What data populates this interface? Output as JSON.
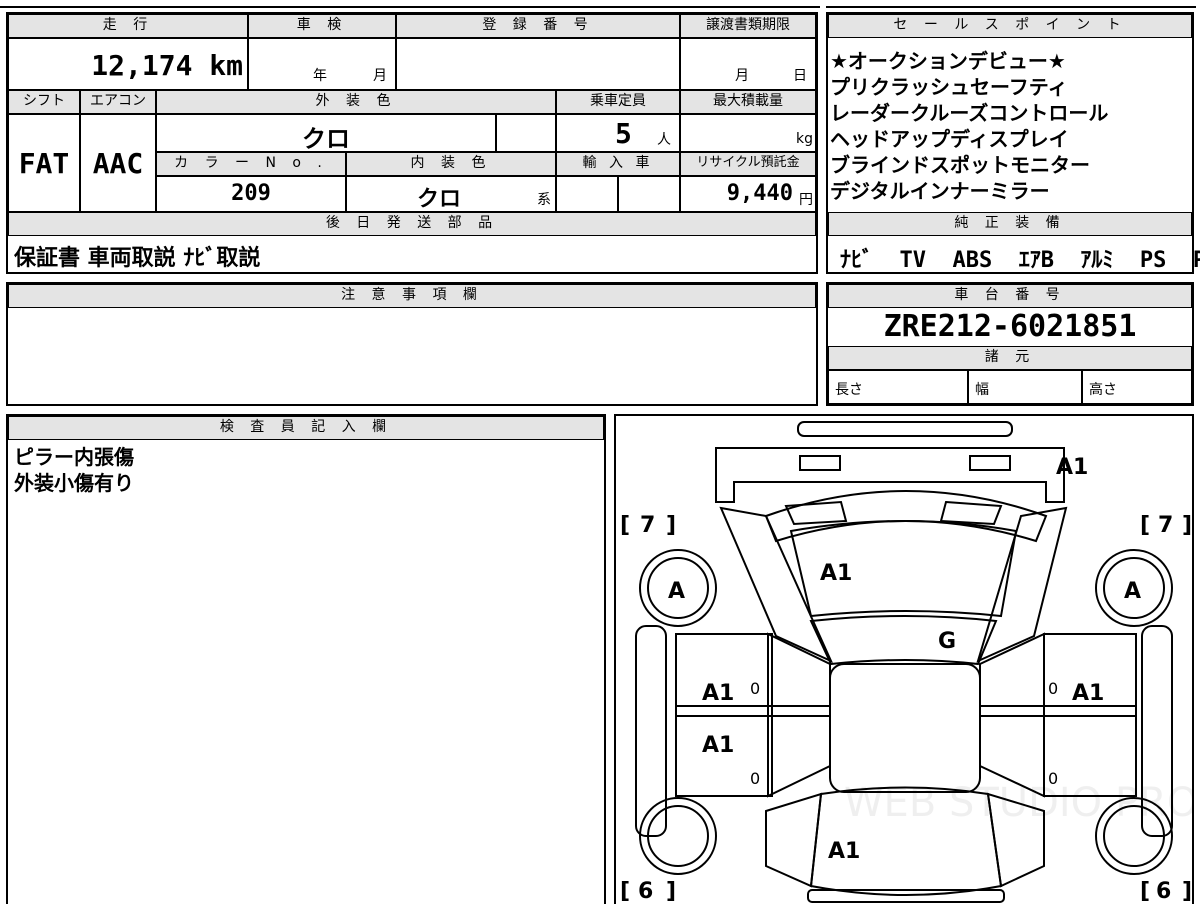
{
  "headers": {
    "mileage": "走 行",
    "inspection": "車 検",
    "registration": "登 録 番 号",
    "transfer_deadline": "譲渡書類期限",
    "shift": "シフト",
    "aircon": "エアコン",
    "exterior_color": "外 装 色",
    "capacity": "乗車定員",
    "max_load": "最大積載量",
    "color_no": "カ ラ ー N o .",
    "interior_color": "内 装 色",
    "import": "輸 入 車",
    "recycle_fee": "リサイクル預託金",
    "later_parts": "後 日 発 送 部 品",
    "sales_points": "セ ー ル ス ポ イ ン ト",
    "genuine_equipment": "純 正 装 備",
    "notes": "注 意 事 項 欄",
    "chassis_no": "車 台 番 号",
    "specs": "諸 元",
    "inspector_notes": "検 査 員 記 入 欄"
  },
  "values": {
    "mileage": "12,174 km",
    "inspection_year_label": "年",
    "inspection_month_label": "月",
    "deadline_month_label": "月",
    "deadline_day_label": "日",
    "shift": "FAT",
    "aircon": "AAC",
    "exterior_color": "クロ",
    "capacity": "5",
    "capacity_unit": "人",
    "max_load_unit": "kg",
    "color_no": "209",
    "interior_color": "クロ",
    "interior_suffix": "系",
    "recycle_fee": "9,440",
    "recycle_unit": "円",
    "later_parts": "保証書 車両取説 ﾅﾋﾞ取説",
    "genuine_equipment": "ﾅﾋﾞ  TV  ABS  ｴｱB  ｱﾙﾐ  PS  PW",
    "chassis_no": "ZRE212-6021851",
    "spec_length": "長さ",
    "spec_width": "幅",
    "spec_height": "高さ"
  },
  "sales_points": [
    "★オークションデビュー★",
    "プリクラッシュセーフティ",
    "レーダークルーズコントロール",
    "ヘッドアップディスプレイ",
    "ブラインドスポットモニター",
    "デジタルインナーミラー"
  ],
  "inspector_notes": [
    "ピラー内張傷",
    "外装小傷有り"
  ],
  "diagram": {
    "marks": {
      "rear": "A1",
      "hood": "A1",
      "windshield": "G",
      "front_left_door": "A1",
      "rear_left_door": "A1",
      "front_right_door": "A1",
      "trunk": "A1",
      "tire_fl": "A",
      "tire_fr": "A",
      "tread_tl": "7",
      "tread_tr": "7",
      "tread_bl": "6",
      "tread_br": "6",
      "zero_a": "0",
      "zero_b": "0",
      "zero_c": "0",
      "zero_d": "0"
    },
    "bracket_open": "[",
    "bracket_close": "]",
    "watermark": "WEB STUDIO PRO"
  }
}
